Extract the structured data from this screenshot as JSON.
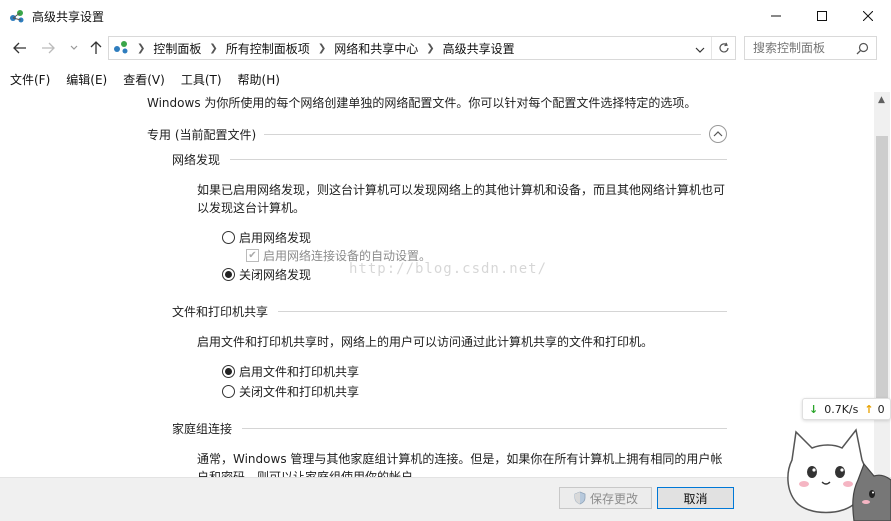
{
  "window": {
    "title": "高级共享设置"
  },
  "nav": {
    "breadcrumbs": [
      "控制面板",
      "所有控制面板项",
      "网络和共享中心",
      "高级共享设置"
    ],
    "search_placeholder": "搜索控制面板"
  },
  "menu": [
    "文件(F)",
    "编辑(E)",
    "查看(V)",
    "工具(T)",
    "帮助(H)"
  ],
  "content": {
    "intro": "Windows 为你所使用的每个网络创建单独的网络配置文件。你可以针对每个配置文件选择特定的选项。",
    "profile": {
      "title": "专用 (当前配置文件)",
      "network_discovery": {
        "title": "网络发现",
        "description": "如果已启用网络发现，则这台计算机可以发现网络上的其他计算机和设备，而且其他网络计算机也可以发现这台计算机。",
        "options": [
          {
            "label": "启用网络发现",
            "selected": false
          },
          {
            "label": "启用网络连接设备的自动设置。",
            "checked": true,
            "disabled": true
          },
          {
            "label": "关闭网络发现",
            "selected": true
          }
        ]
      },
      "file_printer_sharing": {
        "title": "文件和打印机共享",
        "description": "启用文件和打印机共享时，网络上的用户可以访问通过此计算机共享的文件和打印机。",
        "options": [
          {
            "label": "启用文件和打印机共享",
            "selected": true
          },
          {
            "label": "关闭文件和打印机共享",
            "selected": false
          }
        ]
      },
      "homegroup": {
        "title": "家庭组连接",
        "description": "通常，Windows 管理与其他家庭组计算机的连接。但是，如果你在所有计算机上拥有相同的用户帐户和密码，则可以让家庭组使用你的帐户。"
      }
    },
    "watermark": "http://blog.csdn.net/"
  },
  "footer": {
    "save_label": "保存更改",
    "cancel_label": "取消"
  },
  "netspeed": {
    "down": "0.7K/s",
    "up": "0"
  },
  "colors": {
    "accent": "#0078d7",
    "down_arrow": "#2aa52a",
    "up_arrow": "#e8a200"
  }
}
